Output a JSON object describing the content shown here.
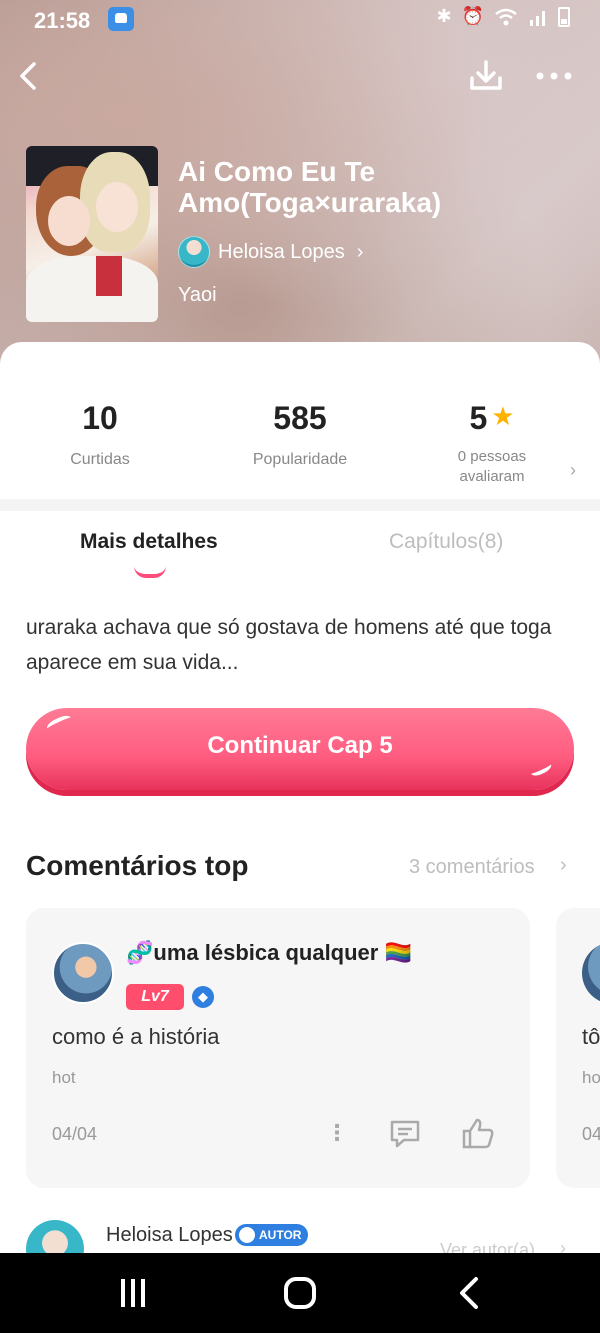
{
  "status_bar": {
    "time": "21:58"
  },
  "book": {
    "title": "Ai Como Eu Te Amo(Toga×uraraka)",
    "author": "Heloisa Lopes",
    "genre": "Yaoi"
  },
  "stats": [
    {
      "value": "10",
      "label": "Curtidas"
    },
    {
      "value": "585",
      "label": "Popularidade"
    },
    {
      "value": "5",
      "label": "0 pessoas avaliaram"
    }
  ],
  "tabs": {
    "details": "Mais detalhes",
    "chapters": "Capítulos(8)"
  },
  "synopsis": "uraraka achava que só gostava de homens até que toga aparece em sua vida...",
  "continue_button": "Continuar Cap 5",
  "comments": {
    "title": "Comentários top",
    "count": "3 comentários",
    "items": [
      {
        "user": "🧬uma lésbica qualquer 🏳️‍🌈",
        "level": "Lv7",
        "text": "como é a história",
        "tag": "hot",
        "date": "04/04"
      },
      {
        "text": "tô",
        "tag": "ho",
        "date": "04"
      }
    ]
  },
  "author_footer": {
    "name": "Heloisa Lopes",
    "badge": "AUTOR",
    "link": "Ver autor(a)"
  },
  "colors": {
    "accent": "#ff5c80",
    "star": "#ffb300",
    "badge_blue": "#2f7fe0"
  },
  "icons": [
    "back-icon",
    "download-icon",
    "more-icon",
    "star-icon",
    "chevron-right-icon",
    "more-vertical-icon",
    "reply-icon",
    "thumbs-up-icon"
  ]
}
